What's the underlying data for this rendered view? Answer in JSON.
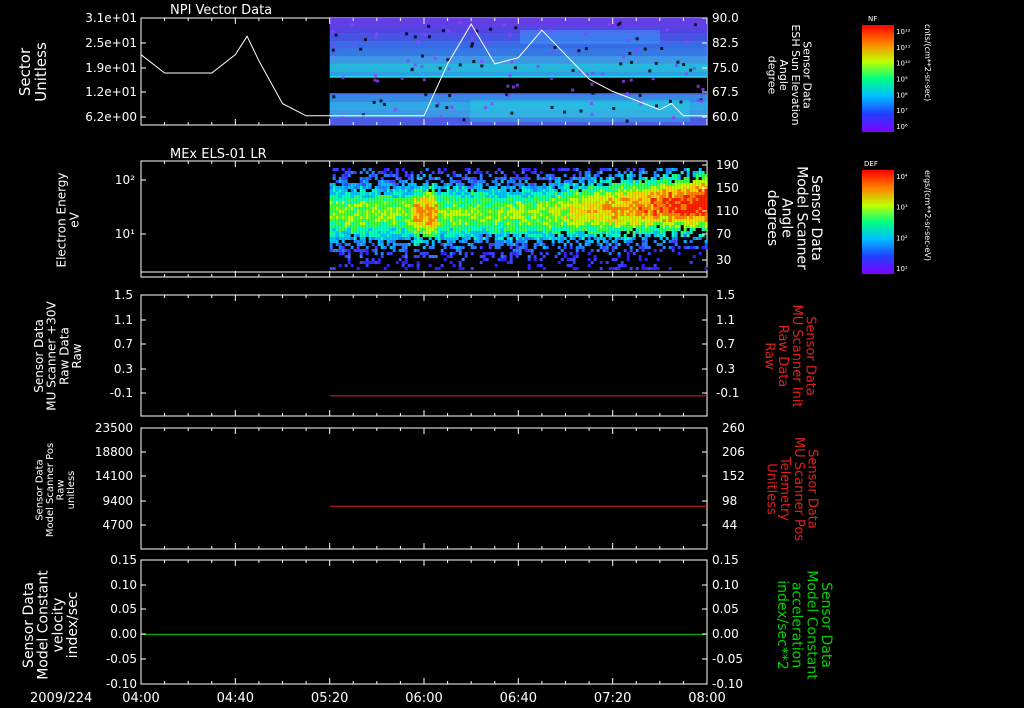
{
  "window": {
    "date_label": "2009/224"
  },
  "time_ticks": [
    "04:00",
    "04:40",
    "05:20",
    "06:00",
    "06:40",
    "07:20",
    "08:00"
  ],
  "panels": [
    {
      "title": "NPI Vector Data",
      "left_label": [
        "Sector",
        "Unitless"
      ],
      "left_ticks": [
        "3.1e+01",
        "2.5e+01",
        "1.9e+01",
        "1.2e+01",
        "6.2e+00"
      ],
      "right_label": [
        "Sensor Data",
        "ESH Sun Elevation",
        "Angle",
        "degree"
      ],
      "right_ticks": [
        "90.0",
        "82.5",
        "75.0",
        "67.5",
        "60.0"
      ],
      "colorbar": {
        "tag": "NF",
        "units": "cnts/(cm**2-sr-sec)",
        "ticks": [
          "10¹²",
          "10¹¹",
          "10¹⁰",
          "10⁹",
          "10⁸",
          "10⁷",
          "10⁶"
        ]
      }
    },
    {
      "title": "MEx ELS-01 LR",
      "left_label": [
        "Electron Energy",
        "eV"
      ],
      "left_ticks": [
        "10²",
        "10¹"
      ],
      "right_label": [
        "Sensor Data",
        "Model Scanner",
        "Angle",
        "degrees"
      ],
      "right_ticks": [
        "190",
        "150",
        "110",
        "70",
        "30"
      ],
      "colorbar": {
        "tag": "DEF",
        "units": "ergs/(cm**2-sr-sec-eV)",
        "ticks": [
          "10⁴",
          "10³",
          "10²",
          "10¹"
        ]
      }
    },
    {
      "left_label": [
        "Sensor Data",
        "MU Scanner +30V",
        "Raw Data",
        "Raw"
      ],
      "left_ticks": [
        "1.5",
        "1.1",
        "0.7",
        "0.3",
        "-0.1"
      ],
      "right_label": [
        "Sensor Data",
        "MU Scanner Init",
        "Raw Data",
        "Raw"
      ],
      "right_ticks": [
        "1.5",
        "1.1",
        "0.7",
        "0.3",
        "-0.1"
      ]
    },
    {
      "left_label": [
        "Sensor Data",
        "Model Scanner Pos",
        "Raw",
        "unitless"
      ],
      "left_ticks": [
        "23500",
        "18800",
        "14100",
        "9400",
        "4700"
      ],
      "right_label": [
        "Sensor Data",
        "MU Scanner Pos",
        "Telemetry",
        "Unitless"
      ],
      "right_ticks": [
        "260",
        "206",
        "152",
        "98",
        "44"
      ]
    },
    {
      "left_label": [
        "Sensor Data",
        "Model Constant",
        "velocity",
        "index/sec"
      ],
      "left_ticks": [
        "0.15",
        "0.10",
        "0.05",
        "0.00",
        "-0.05",
        "-0.10"
      ],
      "right_label": [
        "Sensor Data",
        "Model Constant",
        "acceleration",
        "index/sec**2"
      ],
      "right_ticks": [
        "0.15",
        "0.10",
        "0.05",
        "0.00",
        "-0.05",
        "-0.10"
      ]
    }
  ],
  "chart_data": [
    {
      "type": "heatmap",
      "title": "NPI Vector Data",
      "y_range": [
        0,
        31
      ],
      "x_range": [
        "04:00",
        "08:00"
      ],
      "data_start": "05:20",
      "overlay_line": {
        "name": "ESH Sun Elevation Angle",
        "y_range": [
          55,
          90
        ],
        "x": [
          "04:00",
          "04:10",
          "04:20",
          "04:30",
          "04:40",
          "04:45",
          "04:50",
          "05:00",
          "05:10",
          "05:20",
          "05:40",
          "06:00",
          "06:10",
          "06:20",
          "06:30",
          "06:40",
          "06:50",
          "07:00",
          "07:10",
          "07:20",
          "07:30",
          "07:40",
          "07:45",
          "07:50",
          "08:00"
        ],
        "y": [
          78,
          72,
          72,
          72,
          78,
          84,
          76,
          62,
          58,
          58,
          58,
          58,
          75,
          88,
          75,
          77,
          86,
          78,
          70,
          66,
          63,
          60,
          62,
          58,
          58
        ]
      }
    },
    {
      "type": "heatmap",
      "title": "MEx ELS-01 LR",
      "y_scale": "log",
      "y_range": [
        1,
        200
      ],
      "x_range": [
        "04:00",
        "08:00"
      ],
      "data_start": "05:20"
    },
    {
      "type": "line",
      "y_range": [
        -0.3,
        1.5
      ],
      "series": [
        {
          "x": [
            "05:20",
            "08:00"
          ],
          "y": [
            0,
            0
          ],
          "color": "#e02020"
        }
      ]
    },
    {
      "type": "line",
      "y_range": [
        0,
        23500
      ],
      "series": [
        {
          "x": [
            "05:20",
            "08:00"
          ],
          "y": [
            8300,
            8300
          ],
          "color": "#e02020"
        }
      ]
    },
    {
      "type": "line",
      "y_range": [
        -0.1,
        0.15
      ],
      "series": [
        {
          "x": [
            "04:00",
            "08:00"
          ],
          "y": [
            0,
            0
          ],
          "color": "#00d000"
        }
      ]
    }
  ]
}
